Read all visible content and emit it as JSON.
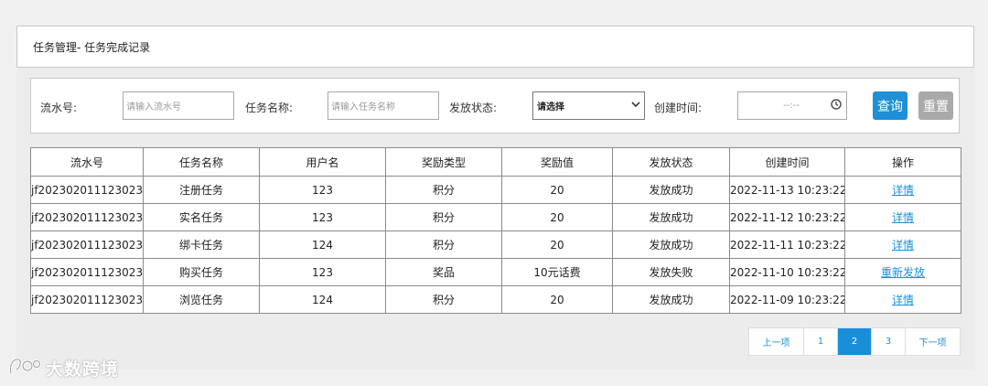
{
  "header": {
    "title": "任务管理- 任务完成记录"
  },
  "filters": {
    "serial_label": "流水号:",
    "serial_placeholder": "请输入流水号",
    "task_label": "任务名称:",
    "task_placeholder": "请输入任务名称",
    "status_label": "发放状态:",
    "status_selected": "请选择",
    "created_label": "创建时间:",
    "created_placeholder": "--:--",
    "query_button": "查询",
    "reset_button": "重置"
  },
  "table": {
    "headers": [
      "流水号",
      "任务名称",
      "用户名",
      "奖励类型",
      "奖励值",
      "发放状态",
      "创建时间",
      "操作"
    ],
    "rows": [
      [
        "jf202302011123023",
        "注册任务",
        "123",
        "积分",
        "20",
        "发放成功",
        "2022-11-13 10:23:22",
        "详情"
      ],
      [
        "jf202302011123023",
        "实名任务",
        "123",
        "积分",
        "20",
        "发放成功",
        "2022-11-12 10:23:22",
        "详情"
      ],
      [
        "jf202302011123023",
        "绑卡任务",
        "124",
        "积分",
        "20",
        "发放成功",
        "2022-11-11 10:23:22",
        "详情"
      ],
      [
        "jf202302011123023",
        "购买任务",
        "123",
        "奖品",
        "10元话费",
        "发放失败",
        "2022-11-10 10:23:22",
        "重新发放"
      ],
      [
        "jf202302011123023",
        "浏览任务",
        "124",
        "积分",
        "20",
        "发放成功",
        "2022-11-09 10:23:22",
        "详情"
      ]
    ]
  },
  "pagination": {
    "prev": "上一项",
    "pages": [
      "1",
      "2",
      "3"
    ],
    "current": "2",
    "next": "下一项"
  },
  "watermark": {
    "text": "大数跨境"
  },
  "colors": {
    "accent": "#1f8fd6",
    "reset": "#a9a9a9",
    "link": "#1a8fd9"
  },
  "icons": {
    "date": "clock-icon",
    "select": "chevron-down-icon",
    "watermark": "brand-logo-icon"
  }
}
